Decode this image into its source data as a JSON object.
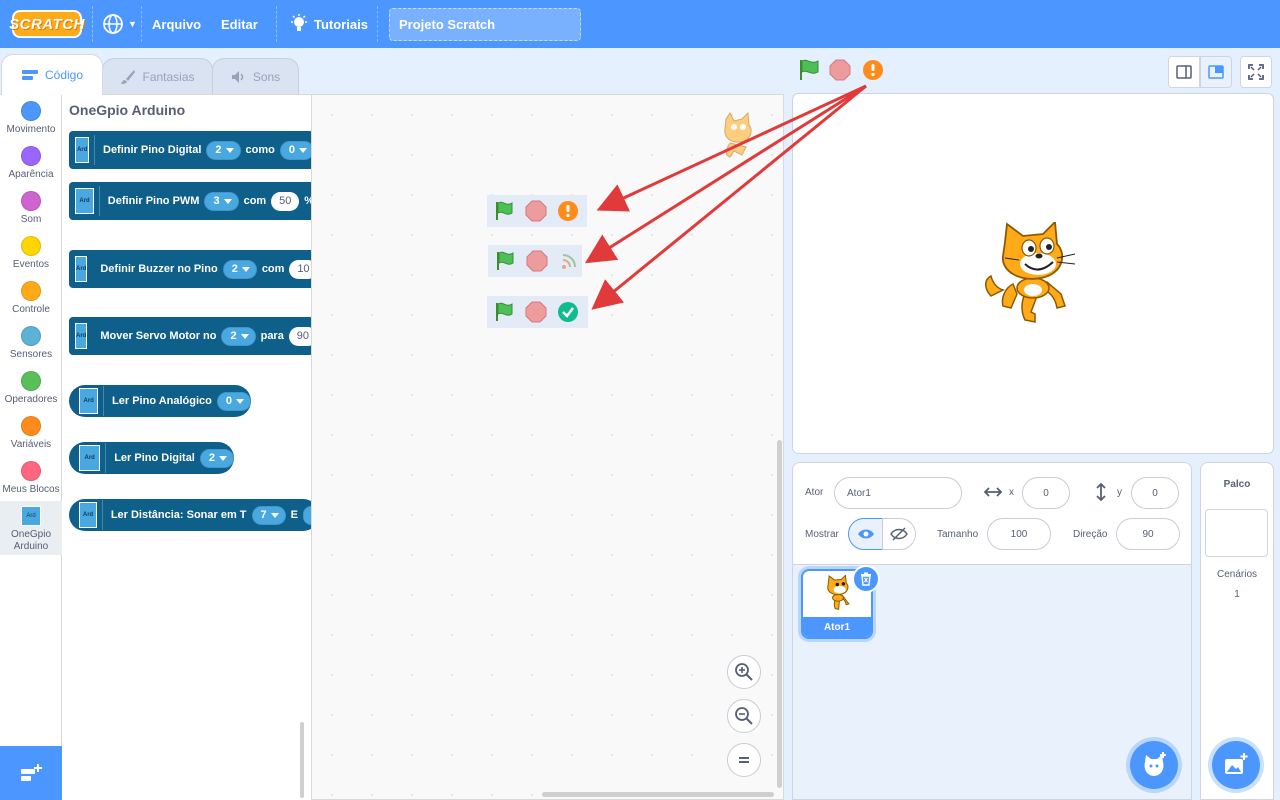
{
  "menu": {
    "logo": "SCRATCH",
    "file": "Arquivo",
    "edit": "Editar",
    "tutorials": "Tutoriais",
    "project_title": "Projeto Scratch"
  },
  "tabs": {
    "code": "Código",
    "costumes": "Fantasias",
    "sounds": "Sons"
  },
  "categories": [
    {
      "label": "Movimento",
      "color": "#4c97ff"
    },
    {
      "label": "Aparência",
      "color": "#9966ff"
    },
    {
      "label": "Som",
      "color": "#cf63cf"
    },
    {
      "label": "Eventos",
      "color": "#ffd500"
    },
    {
      "label": "Controle",
      "color": "#ffab19"
    },
    {
      "label": "Sensores",
      "color": "#5cb1d6"
    },
    {
      "label": "Operadores",
      "color": "#59c059"
    },
    {
      "label": "Variáveis",
      "color": "#ff8c1a"
    },
    {
      "label": "Meus Blocos",
      "color": "#ff6680"
    },
    {
      "label": "OneGpio Arduino",
      "color": "#4aa8e0"
    }
  ],
  "palette": {
    "title": "OneGpio Arduino",
    "icon_text": "Ard",
    "blocks": [
      {
        "text": "Definir Pino Digital",
        "arg1": "2",
        "mid": "como",
        "arg2": "0"
      },
      {
        "text": "Definir Pino PWM",
        "arg1": "3",
        "mid": "com",
        "arg2": "50",
        "suffix": "%"
      },
      {
        "text": "Definir Buzzer no Pino",
        "arg1": "2",
        "mid": "com",
        "arg2": "10"
      },
      {
        "text": "Mover Servo Motor no",
        "arg1": "2",
        "mid": "para",
        "arg2": "90"
      },
      {
        "text": "Ler Pino Analógico",
        "arg1": "0"
      },
      {
        "text": "Ler Pino Digital",
        "arg1": "2"
      },
      {
        "text": "Ler Distância: Sonar em T",
        "arg1": "7",
        "mid": "E"
      }
    ]
  },
  "sprite_info": {
    "sprite_label": "Ator",
    "sprite_name": "Ator1",
    "x_label": "x",
    "x_value": "0",
    "y_label": "y",
    "y_value": "0",
    "show_label": "Mostrar",
    "size_label": "Tamanho",
    "size_value": "100",
    "direction_label": "Direção",
    "direction_value": "90"
  },
  "sprite_list": [
    {
      "name": "Ator1"
    }
  ],
  "stage_pane": {
    "title": "Palco",
    "backdrops_label": "Cenários",
    "backdrops_count": "1"
  },
  "status_icons": [
    "connection-warning-icon",
    "connection-connecting-icon",
    "connection-ok-icon"
  ],
  "colors": {
    "accent": "#4c97ff",
    "block": "#0e5f8a",
    "warning": "#ff8c1a",
    "ok": "#0fbd8c",
    "arrow": "#e03a3a"
  }
}
